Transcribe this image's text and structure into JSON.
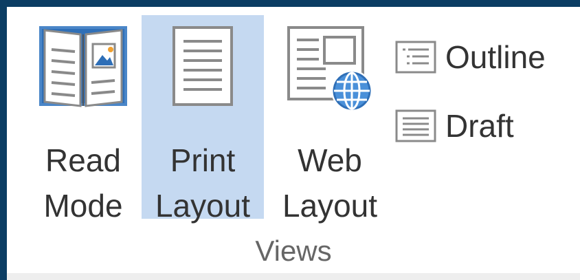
{
  "views_group": {
    "read_mode": {
      "line1": "Read",
      "line2": "Mode",
      "icon": "book-icon"
    },
    "print_layout": {
      "line1": "Print",
      "line2": "Layout",
      "icon": "page-icon",
      "selected": true
    },
    "web_layout": {
      "line1": "Web",
      "line2": "Layout",
      "icon": "web-page-globe-icon"
    },
    "outline": {
      "label": "Outline",
      "icon": "outline-icon"
    },
    "draft": {
      "label": "Draft",
      "icon": "draft-icon"
    },
    "group_label": "Views"
  },
  "colors": {
    "window_border": "#0b3d63",
    "selected_bg": "#c5d9f1",
    "icon_blue": "#2f6fb7",
    "icon_gray": "#8a8a8a",
    "text": "#333333"
  }
}
